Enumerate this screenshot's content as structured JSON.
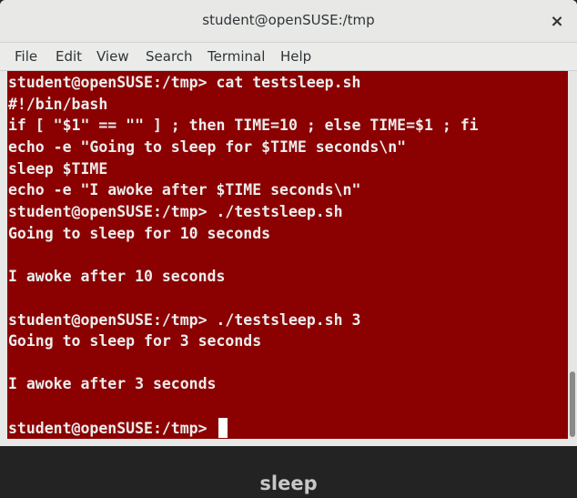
{
  "window": {
    "title": "student@openSUSE:/tmp",
    "close_glyph": "×"
  },
  "menu": [
    "File",
    "Edit",
    "View",
    "Search",
    "Terminal",
    "Help"
  ],
  "terminal": {
    "background_color": "#8b0000",
    "text_color": "#ededed",
    "lines": [
      "student@openSUSE:/tmp> cat testsleep.sh",
      "#!/bin/bash",
      "if [ \"$1\" == \"\" ] ; then TIME=10 ; else TIME=$1 ; fi",
      "echo -e \"Going to sleep for $TIME seconds\\n\"",
      "sleep $TIME",
      "echo -e \"I awoke after $TIME seconds\\n\"",
      "student@openSUSE:/tmp> ./testsleep.sh",
      "Going to sleep for 10 seconds",
      "",
      "I awoke after 10 seconds",
      "",
      "student@openSUSE:/tmp> ./testsleep.sh 3",
      "Going to sleep for 3 seconds",
      "",
      "I awoke after 3 seconds",
      "",
      "student@openSUSE:/tmp> "
    ]
  },
  "caption": "sleep"
}
